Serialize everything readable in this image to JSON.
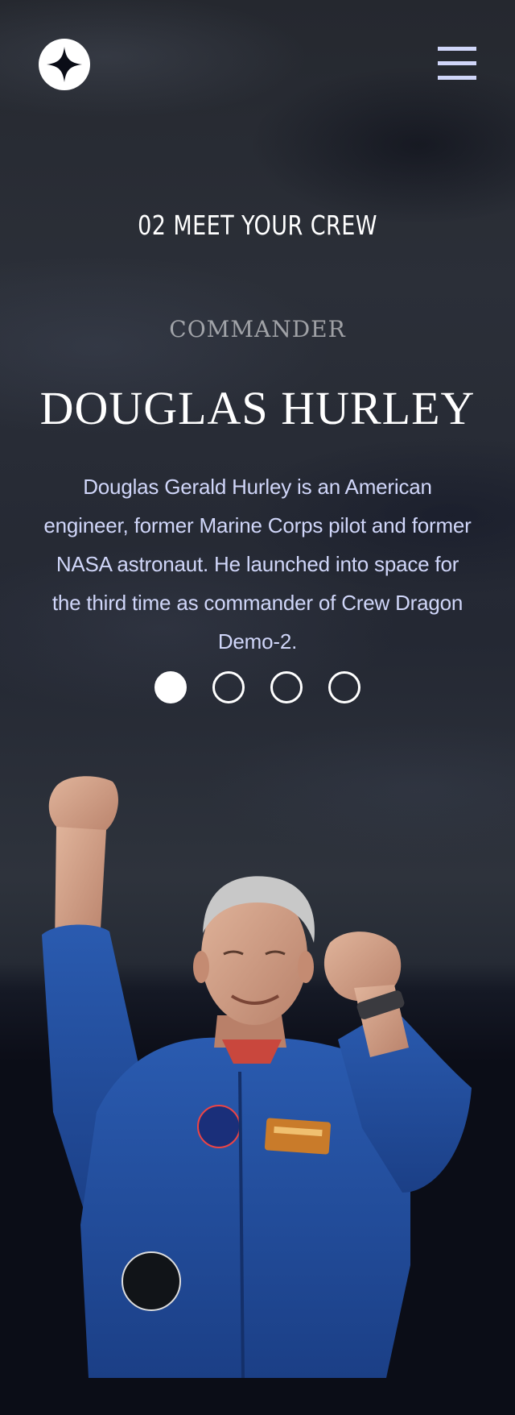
{
  "header": {
    "logo_icon": "star-logo-icon",
    "menu_icon": "hamburger-menu-icon"
  },
  "page": {
    "heading_number": "02",
    "heading_text": "MEET YOUR CREW"
  },
  "crew": {
    "role": "COMMANDER",
    "name": "DOUGLAS HURLEY",
    "bio": "Douglas Gerald Hurley is an American engineer, former Marine Corps pilot and former NASA astronaut. He launched into space for the third time as commander of Crew Dragon Demo-2.",
    "selected_index": 0,
    "member_count": 4
  },
  "colors": {
    "background": "#0b0d17",
    "accent_text": "#d0d6f9",
    "white": "#ffffff"
  }
}
